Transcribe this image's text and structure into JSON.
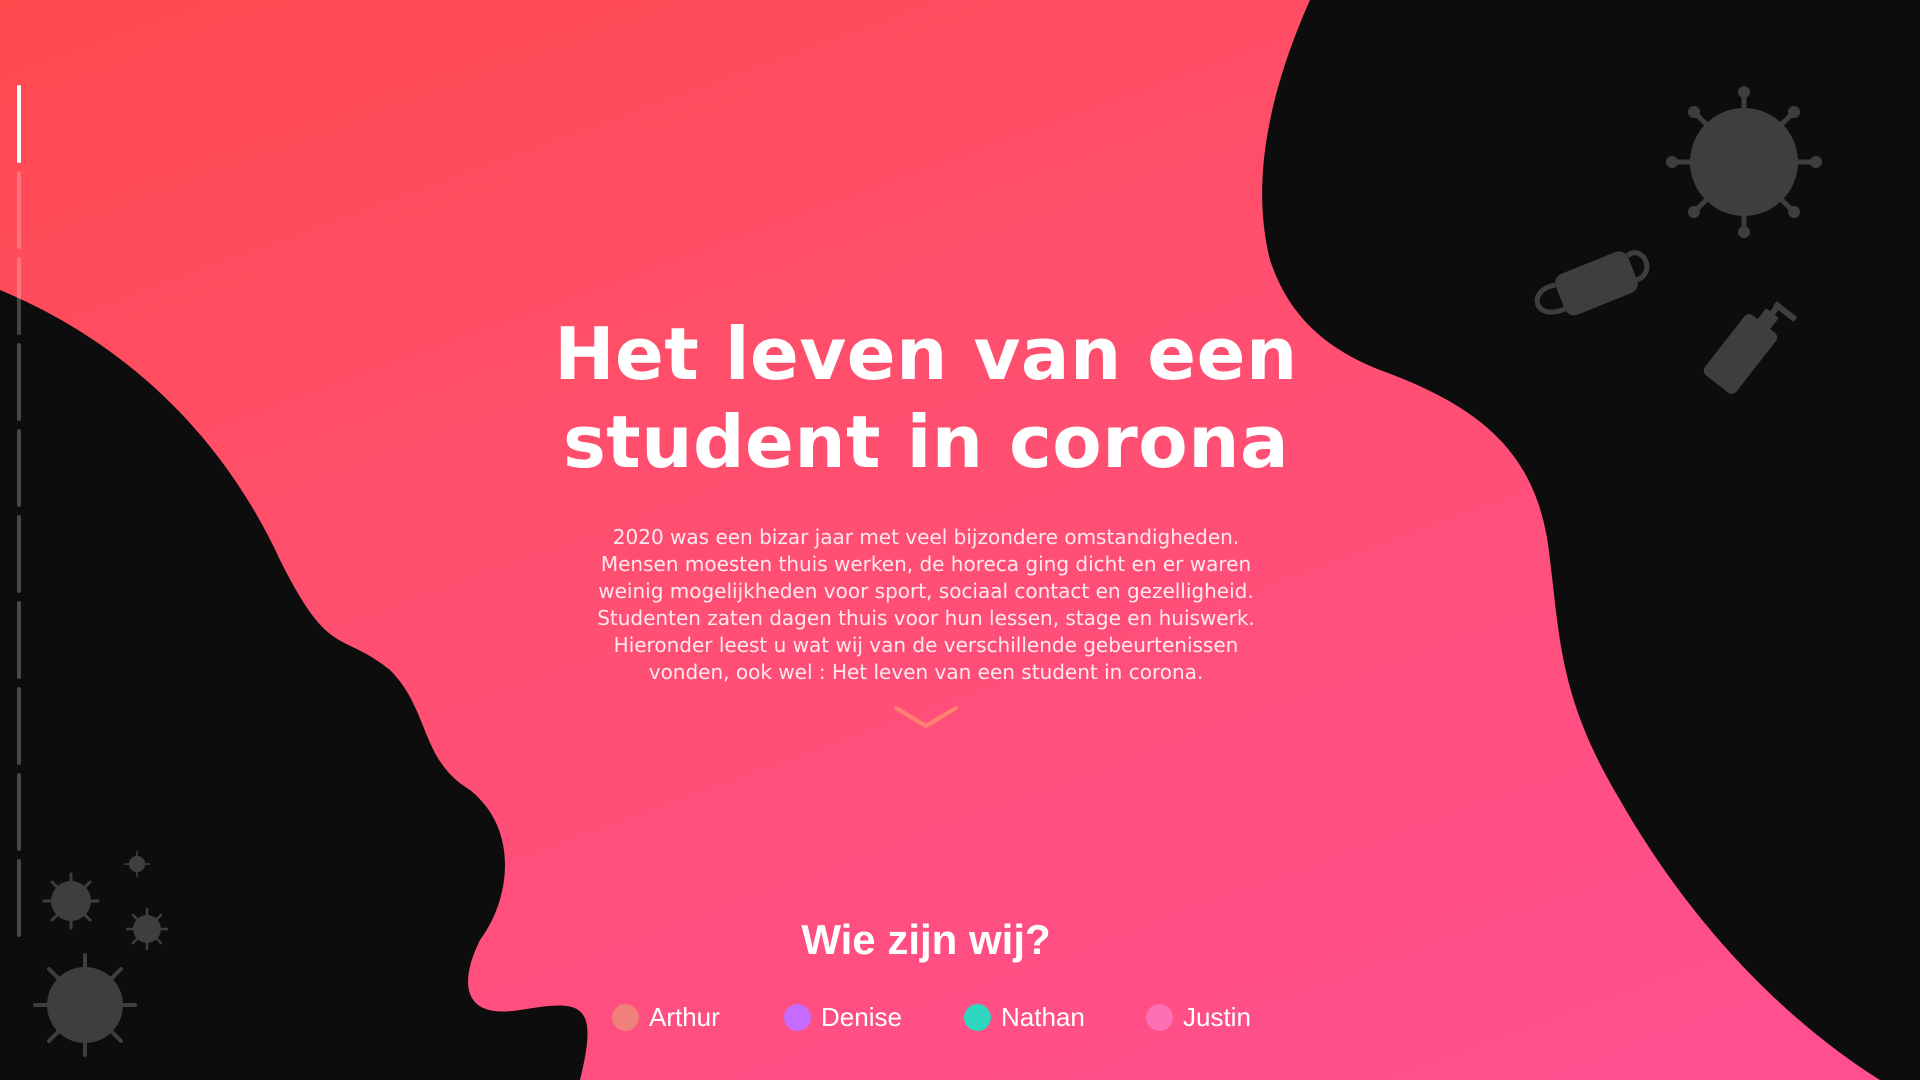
{
  "hero": {
    "title_line1": "Het leven van een",
    "title_line2": "student in corona",
    "intro": "2020 was een bizar jaar met veel bijzondere omstandigheden.\nMensen moesten thuis werken, de horeca ging dicht en er waren\nweinig mogelijkheden voor sport, sociaal contact en gezelligheid.\nStudenten zaten dagen thuis voor hun lessen, stage en huiswerk.\nHieronder leest u wat wij van de verschillende gebeurtenissen\nvonden, ook wel : Het leven van een student in corona."
  },
  "scroll_icon": "chevron-down-icon",
  "team": {
    "title": "Wie zijn wij?",
    "members": [
      {
        "name": "Arthur",
        "color": "#f0807a"
      },
      {
        "name": "Denise",
        "color": "#c56bff"
      },
      {
        "name": "Nathan",
        "color": "#2fd6c0"
      },
      {
        "name": "Justin",
        "color": "#ff6fb4"
      }
    ]
  },
  "progress": {
    "segments_total": 10,
    "active_index": 0
  },
  "colors": {
    "gradient_start": "#ff4a4e",
    "gradient_end": "#ff4f92",
    "dark_shape": "#0d0d0d",
    "icon_gray": "#3e3e3e"
  },
  "decorations": [
    "virus-icon",
    "face-mask-icon",
    "sanitizer-bottle-icon"
  ]
}
